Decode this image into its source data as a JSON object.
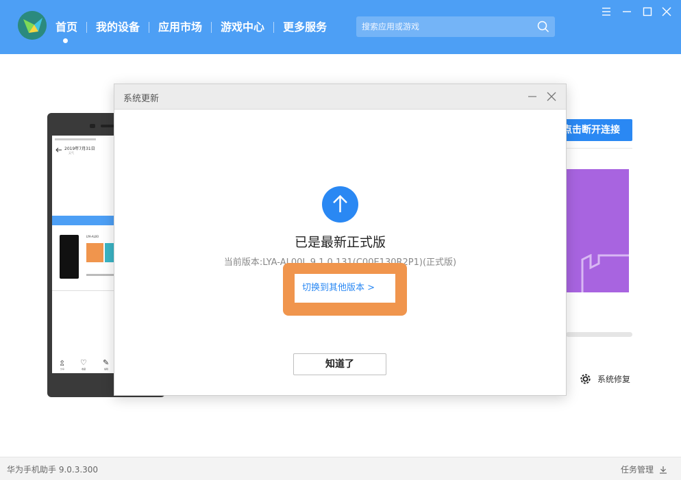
{
  "app": {
    "nav": [
      "首页",
      "我的设备",
      "应用市场",
      "游戏中心",
      "更多服务"
    ],
    "search_placeholder": "搜索应用或游戏"
  },
  "background": {
    "disconnect_label": "点击断开连接",
    "repair_label": "系统修复",
    "phone_screen": {
      "date": "2019年7月31日",
      "sub": "天气",
      "mini_model": "LYA-AL00",
      "bottom_icons": [
        "分享",
        "收藏",
        "编辑"
      ]
    }
  },
  "dialog": {
    "title": "系统更新",
    "status": "已是最新正式版",
    "version": "当前版本:LYA-AL00L 9.1.0.131(C00E130R2P1)(正式版)",
    "switch_link": "切换到其他版本 >",
    "ok_button": "知道了"
  },
  "footer": {
    "version": "华为手机助手 9.0.3.300",
    "tasks": "任务管理"
  },
  "colors": {
    "header": "#4d9ff5",
    "accent": "#2a88f3",
    "highlight": "#f0954d",
    "purple": "#a864e0"
  }
}
